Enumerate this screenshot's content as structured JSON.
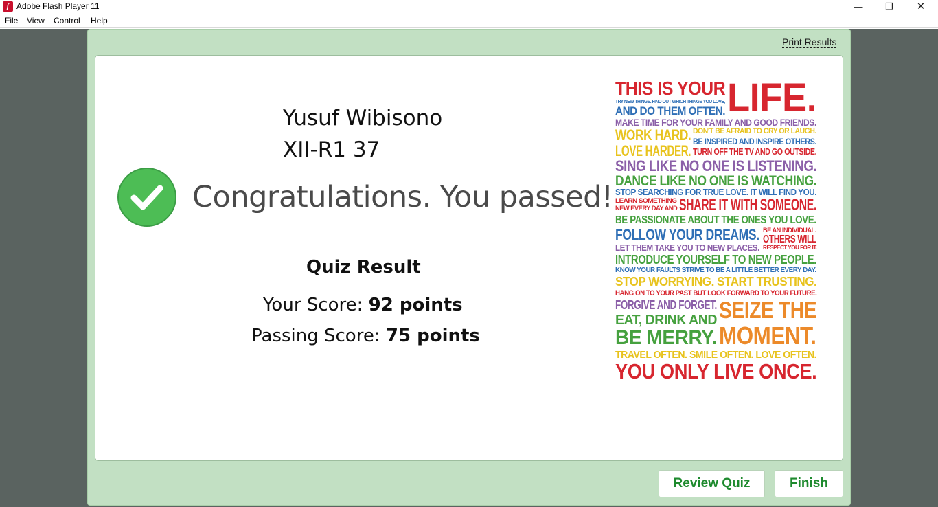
{
  "window": {
    "title": "Adobe Flash Player 11",
    "app_icon_letter": "f",
    "controls": {
      "minimize": "—",
      "maximize": "❐",
      "close": "✕"
    }
  },
  "menu": {
    "items": [
      {
        "label": "File"
      },
      {
        "label": "View"
      },
      {
        "label": "Control"
      },
      {
        "label": "Help"
      }
    ]
  },
  "quiz": {
    "print_link": "Print Results",
    "student_name": "Yusuf Wibisono",
    "student_class": "XII-R1 37",
    "message": "Congratulations. You passed!",
    "result_title": "Quiz Result",
    "your_score_label": "Your Score: ",
    "your_score_value": "92 points",
    "passing_score_label": "Passing Score: ",
    "passing_score_value": "75 points",
    "buttons": {
      "review": "Review Quiz",
      "finish": "Finish"
    }
  },
  "poster": {
    "lines": [
      {
        "text": "THIS IS YOUR",
        "color": "#d7262f"
      },
      {
        "text": "LIFE.",
        "color": "#d7262f"
      },
      {
        "text": "TRY NEW THINGS. FIND OUT WHICH THINGS YOU LOVE,",
        "color": "#2f6fb6"
      },
      {
        "text": "AND DO THEM OFTEN.",
        "color": "#2f6fb6"
      },
      {
        "text": "MAKE TIME FOR YOUR FAMILY AND GOOD FRIENDS.",
        "color": "#8b5fa8"
      },
      {
        "text": "WORK HARD.",
        "color": "#e8c31e"
      },
      {
        "text": "DON'T BE AFRAID TO CRY OR LAUGH.",
        "color": "#e8c31e"
      },
      {
        "text": "BE INSPIRED AND INSPIRE OTHERS.",
        "color": "#2f6fb6"
      },
      {
        "text": "LOVE HARDER.",
        "color": "#e8c31e"
      },
      {
        "text": "TURN OFF THE TV AND GO OUTSIDE.",
        "color": "#d7262f"
      },
      {
        "text": "SING LIKE NO ONE IS LISTENING.",
        "color": "#8b5fa8"
      },
      {
        "text": "DANCE LIKE NO ONE IS WATCHING.",
        "color": "#46a13f"
      },
      {
        "text": "STOP SEARCHING FOR TRUE LOVE. IT WILL FIND YOU.",
        "color": "#2f6fb6"
      },
      {
        "text": "LEARN SOMETHING",
        "color": "#d7262f"
      },
      {
        "text": "NEW EVERY DAY AND",
        "color": "#d7262f"
      },
      {
        "text": "SHARE IT WITH SOMEONE.",
        "color": "#d7262f"
      },
      {
        "text": "BE PASSIONATE ABOUT THE ONES YOU LOVE.",
        "color": "#46a13f"
      },
      {
        "text": "FOLLOW YOUR DREAMS.",
        "color": "#2f6fb6"
      },
      {
        "text": "BE AN INDIVIDUAL.",
        "color": "#d7262f"
      },
      {
        "text": "OTHERS WILL",
        "color": "#d7262f"
      },
      {
        "text": "LET THEM TAKE YOU TO NEW PLACES.",
        "color": "#8b5fa8"
      },
      {
        "text": "RESPECT YOU FOR IT.",
        "color": "#d7262f"
      },
      {
        "text": "INTRODUCE YOURSELF TO NEW PEOPLE.",
        "color": "#46a13f"
      },
      {
        "text": "KNOW YOUR FAULTS  STRIVE TO BE A LITTLE BETTER EVERY DAY.",
        "color": "#2f6fb6"
      },
      {
        "text": "STOP WORRYING. START TRUSTING.",
        "color": "#e8c31e"
      },
      {
        "text": "HANG ON TO YOUR PAST BUT LOOK FORWARD TO YOUR FUTURE.",
        "color": "#d7262f"
      },
      {
        "text": "FORGIVE AND FORGET.",
        "color": "#8b5fa8"
      },
      {
        "text": "SEIZE THE",
        "color": "#ec8a2a"
      },
      {
        "text": "EAT, DRINK AND",
        "color": "#46a13f"
      },
      {
        "text": "BE MERRY.",
        "color": "#46a13f"
      },
      {
        "text": "MOMENT.",
        "color": "#ec8a2a"
      },
      {
        "text": "TRAVEL OFTEN. SMILE OFTEN. LOVE OFTEN.",
        "color": "#e8c31e"
      },
      {
        "text": "YOU ONLY LIVE ONCE.",
        "color": "#d7262f"
      }
    ]
  }
}
